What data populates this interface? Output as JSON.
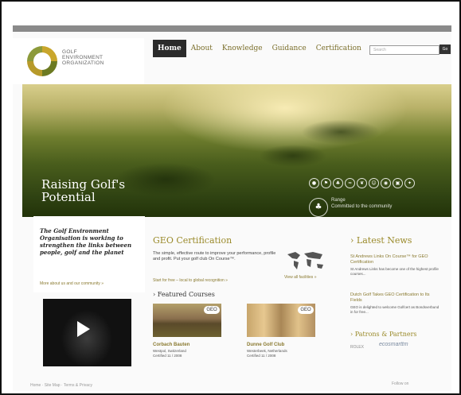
{
  "logo": {
    "line1": "GOLF",
    "line2": "ENVIRONMENT",
    "line3": "ORGANIZATION"
  },
  "nav": [
    {
      "label": "Home",
      "active": true
    },
    {
      "label": "About"
    },
    {
      "label": "Knowledge"
    },
    {
      "label": "Guidance"
    },
    {
      "label": "Certification"
    }
  ],
  "search": {
    "placeholder": "Search",
    "button": "Go"
  },
  "hero": {
    "title_line1": "Raising Golf's",
    "title_line2": "Potential",
    "small_line1": "Range",
    "small_line2": "Committed to the community",
    "icons": [
      "golf-ball-icon",
      "flag-icon",
      "tree-icon",
      "water-icon",
      "leaf-icon",
      "people-icon",
      "globe-icon",
      "building-icon",
      "bird-icon"
    ]
  },
  "about": {
    "text": "The Golf Environment Organisation is working to strengthen the links between people, golf and the planet",
    "link": "More about us and our community »"
  },
  "geo": {
    "title": "GEO Certification",
    "text": "The simple, effective route to improve your performance, profile and profit. Put your golf club On Course™.",
    "link": "Start for free – local to global recognition »",
    "viewall": "View all facilities »"
  },
  "featured": {
    "title": "Featured Courses",
    "courses": [
      {
        "name": "Corbach Bauten",
        "location": "Westpol, Switzerland",
        "certified": "Certified 11 / 2008",
        "badge": "GEO"
      },
      {
        "name": "Dunne Golf Club",
        "location": "Westerbeek, Netherlands",
        "certified": "Certified 11 / 2008",
        "badge": "GEO"
      }
    ]
  },
  "news": {
    "title": "Latest News",
    "items": [
      {
        "headline": "St Andrews Links On Course™ for GEO Certification",
        "body": "St Andrews Links has become one of the highest profile courses..."
      },
      {
        "headline": "Dutch Golf Takes GEO Certification to Its Fields",
        "body": "GEO is delighted to welcome Golfcert as Bondsverbund in for free..."
      }
    ]
  },
  "partners": {
    "title": "Patrons & Partners",
    "p1": "ROLEX",
    "p2": "ecosmarttm"
  },
  "footer": {
    "left": "Home · Site Map · Terms & Privacy",
    "right": "Follow on"
  }
}
